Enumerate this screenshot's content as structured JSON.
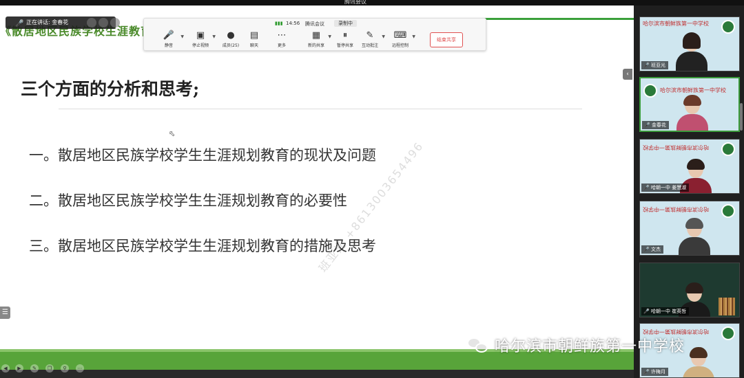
{
  "window": {
    "title": "腾讯会议"
  },
  "speaking": {
    "label": "正在讲话: 金春花"
  },
  "slide": {
    "header": "《散居地区民族学校生涯教育现状",
    "title": "三个方面的分析和思考;",
    "items": [
      "一。散居地区民族学校学生生涯规划教育的现状及问题",
      "二。散居地区民族学校学生生涯规划教育的必要性",
      "三。散居地区民族学校学生生涯规划教育的措施及思考"
    ],
    "watermark": "班亚光 +8613003654496"
  },
  "toolbar": {
    "time": "14:56",
    "app_name": "腾讯会议",
    "recording": "录制中",
    "buttons": [
      {
        "label": "静音",
        "icon": "mic-icon"
      },
      {
        "label": "停止视频",
        "icon": "video-icon"
      },
      {
        "label": "成员(25)",
        "icon": "members-icon"
      },
      {
        "label": "聊天",
        "icon": "chat-icon"
      },
      {
        "label": "更多",
        "icon": "more-icon"
      },
      {
        "label": "新的共享",
        "icon": "share-icon"
      },
      {
        "label": "暂停共享",
        "icon": "pause-icon"
      },
      {
        "label": "互动批注",
        "icon": "annotate-icon"
      },
      {
        "label": "远程控制",
        "icon": "remote-control-icon"
      }
    ],
    "end_share": "结束共享"
  },
  "participants": [
    {
      "name": "班亚光",
      "school": "哈尔滨市朝鲜族第一中学校",
      "speaking": false
    },
    {
      "name": "金春花",
      "school": "哈尔滨市朝鲜族第一中学校",
      "speaking": true
    },
    {
      "name": "哈朝一中 姜慧淑",
      "school": "哈尔滨市朝鲜族第一中学校",
      "speaking": false
    },
    {
      "name": "文杰",
      "school": "哈尔滨市朝鲜族第一中学校",
      "speaking": false
    },
    {
      "name": "哈朝一中 崔英哲",
      "school": "",
      "speaking": false
    },
    {
      "name": "许梅月",
      "school": "哈尔滨市朝鲜族第一中学校",
      "speaking": false
    }
  ],
  "wechat_watermark": "哈尔滨市朝鲜族第一中学校",
  "colors": {
    "accent_green": "#58a43a",
    "end_share_red": "#e05050",
    "school_red": "#c03030"
  }
}
